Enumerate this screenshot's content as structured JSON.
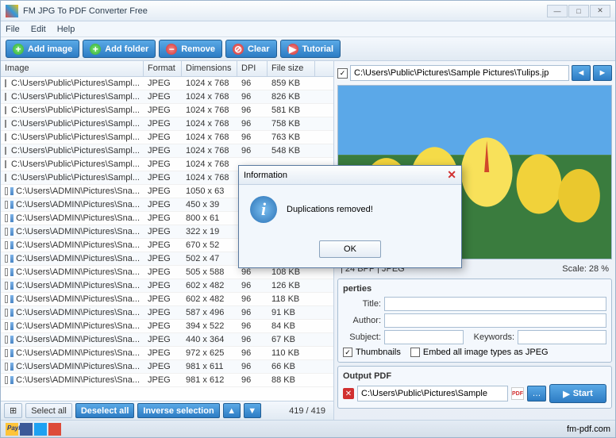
{
  "window": {
    "title": "FM JPG To PDF Converter Free"
  },
  "menu": {
    "file": "File",
    "edit": "Edit",
    "help": "Help"
  },
  "toolbar": {
    "add_image": "Add image",
    "add_folder": "Add folder",
    "remove": "Remove",
    "clear": "Clear",
    "tutorial": "Tutorial"
  },
  "table": {
    "headers": {
      "image": "Image",
      "format": "Format",
      "dimensions": "Dimensions",
      "dpi": "DPI",
      "filesize": "File size"
    },
    "rows": [
      {
        "path": "C:\\Users\\Public\\Pictures\\Sampl...",
        "fmt": "JPEG",
        "dim": "1024 x 768",
        "dpi": "96",
        "size": "859 KB"
      },
      {
        "path": "C:\\Users\\Public\\Pictures\\Sampl...",
        "fmt": "JPEG",
        "dim": "1024 x 768",
        "dpi": "96",
        "size": "826 KB"
      },
      {
        "path": "C:\\Users\\Public\\Pictures\\Sampl...",
        "fmt": "JPEG",
        "dim": "1024 x 768",
        "dpi": "96",
        "size": "581 KB"
      },
      {
        "path": "C:\\Users\\Public\\Pictures\\Sampl...",
        "fmt": "JPEG",
        "dim": "1024 x 768",
        "dpi": "96",
        "size": "758 KB"
      },
      {
        "path": "C:\\Users\\Public\\Pictures\\Sampl...",
        "fmt": "JPEG",
        "dim": "1024 x 768",
        "dpi": "96",
        "size": "763 KB"
      },
      {
        "path": "C:\\Users\\Public\\Pictures\\Sampl...",
        "fmt": "JPEG",
        "dim": "1024 x 768",
        "dpi": "96",
        "size": "548 KB"
      },
      {
        "path": "C:\\Users\\Public\\Pictures\\Sampl...",
        "fmt": "JPEG",
        "dim": "1024 x 768",
        "dpi": "",
        "size": ""
      },
      {
        "path": "C:\\Users\\Public\\Pictures\\Sampl...",
        "fmt": "JPEG",
        "dim": "1024 x 768",
        "dpi": "",
        "size": ""
      },
      {
        "path": "C:\\Users\\ADMIN\\Pictures\\Sna...",
        "fmt": "JPEG",
        "dim": "1050 x 63",
        "dpi": "",
        "size": ""
      },
      {
        "path": "C:\\Users\\ADMIN\\Pictures\\Sna...",
        "fmt": "JPEG",
        "dim": "450 x 39",
        "dpi": "",
        "size": ""
      },
      {
        "path": "C:\\Users\\ADMIN\\Pictures\\Sna...",
        "fmt": "JPEG",
        "dim": "800 x 61",
        "dpi": "",
        "size": ""
      },
      {
        "path": "C:\\Users\\ADMIN\\Pictures\\Sna...",
        "fmt": "JPEG",
        "dim": "322 x 19",
        "dpi": "",
        "size": ""
      },
      {
        "path": "C:\\Users\\ADMIN\\Pictures\\Sna...",
        "fmt": "JPEG",
        "dim": "670 x 52",
        "dpi": "",
        "size": ""
      },
      {
        "path": "C:\\Users\\ADMIN\\Pictures\\Sna...",
        "fmt": "JPEG",
        "dim": "502 x 47",
        "dpi": "",
        "size": ""
      },
      {
        "path": "C:\\Users\\ADMIN\\Pictures\\Sna...",
        "fmt": "JPEG",
        "dim": "505 x 588",
        "dpi": "96",
        "size": "108 KB"
      },
      {
        "path": "C:\\Users\\ADMIN\\Pictures\\Sna...",
        "fmt": "JPEG",
        "dim": "602 x 482",
        "dpi": "96",
        "size": "126 KB"
      },
      {
        "path": "C:\\Users\\ADMIN\\Pictures\\Sna...",
        "fmt": "JPEG",
        "dim": "602 x 482",
        "dpi": "96",
        "size": "118 KB"
      },
      {
        "path": "C:\\Users\\ADMIN\\Pictures\\Sna...",
        "fmt": "JPEG",
        "dim": "587 x 496",
        "dpi": "96",
        "size": "91 KB"
      },
      {
        "path": "C:\\Users\\ADMIN\\Pictures\\Sna...",
        "fmt": "JPEG",
        "dim": "394 x 522",
        "dpi": "96",
        "size": "84 KB"
      },
      {
        "path": "C:\\Users\\ADMIN\\Pictures\\Sna...",
        "fmt": "JPEG",
        "dim": "440 x 364",
        "dpi": "96",
        "size": "67 KB"
      },
      {
        "path": "C:\\Users\\ADMIN\\Pictures\\Sna...",
        "fmt": "JPEG",
        "dim": "972 x 625",
        "dpi": "96",
        "size": "110 KB"
      },
      {
        "path": "C:\\Users\\ADMIN\\Pictures\\Sna...",
        "fmt": "JPEG",
        "dim": "981 x 611",
        "dpi": "96",
        "size": "66 KB"
      },
      {
        "path": "C:\\Users\\ADMIN\\Pictures\\Sna...",
        "fmt": "JPEG",
        "dim": "981 x 612",
        "dpi": "96",
        "size": "88 KB"
      }
    ]
  },
  "selection": {
    "select_all": "Select all",
    "deselect_all": "Deselect all",
    "inverse": "Inverse selection",
    "count": "419 / 419"
  },
  "preview": {
    "path": "C:\\Users\\Public\\Pictures\\Sample Pictures\\Tulips.jp",
    "info": "| 24 BPP | JPEG",
    "scale": "Scale: 28 %"
  },
  "properties": {
    "group_title": "perties",
    "title_label": "Title:",
    "author_label": "Author:",
    "subject_label": "Subject:",
    "keywords_label": "Keywords:",
    "thumbnails": "Thumbnails",
    "embed_jpeg": "Embed all image types as JPEG"
  },
  "output": {
    "group_title": "Output PDF",
    "path": "C:\\Users\\Public\\Pictures\\Sample",
    "start": "Start"
  },
  "footer": {
    "site": "fm-pdf.com"
  },
  "dialog": {
    "title": "Information",
    "message": "Duplications removed!",
    "ok": "OK"
  }
}
